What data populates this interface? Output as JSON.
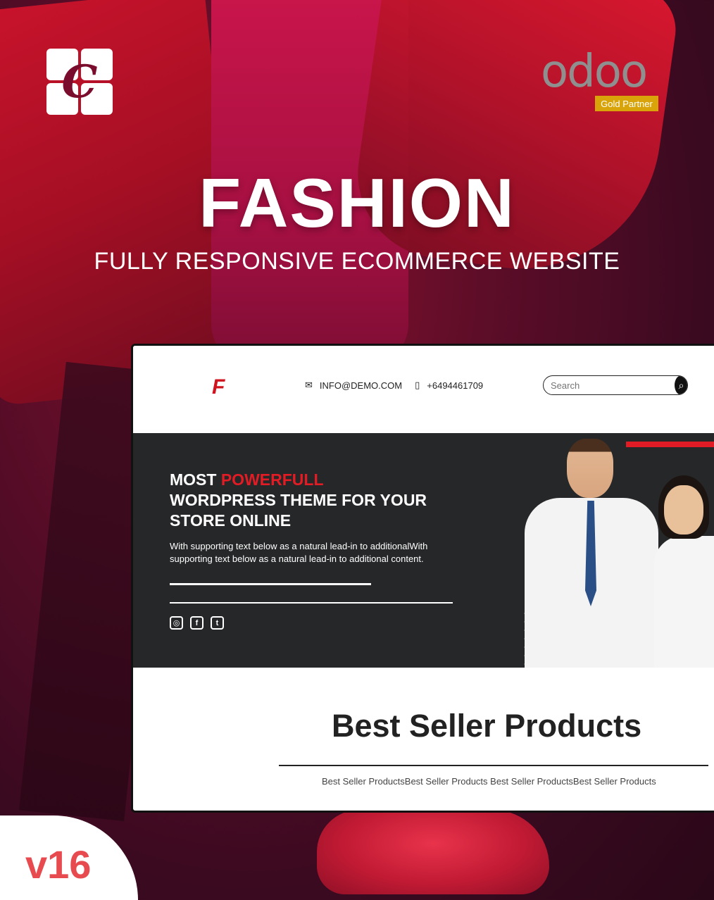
{
  "brand": {
    "logo_letter": "C"
  },
  "partner": {
    "name": "odoo",
    "badge": "Gold Partner"
  },
  "hero": {
    "title": "FASHION",
    "subtitle": "FULLY RESPONSIVE ECOMMERCE WEBSITE"
  },
  "mock_site": {
    "logo": "F",
    "email": "INFO@DEMO.COM",
    "phone": "+6494461709",
    "search_placeholder": "Search",
    "banner": {
      "headline_part1": "MOST ",
      "headline_highlight": "POWERFULL",
      "headline_part2": "WORDPRESS THEME FOR YOUR STORE ONLINE",
      "body": "With supporting text below as a natural lead-in to additionalWith supporting text below as a natural lead-in to additional content."
    },
    "section_title": "Best Seller Products",
    "section_sub": "Best Seller ProductsBest Seller Products Best Seller ProductsBest Seller Products"
  },
  "version": "v16",
  "colors": {
    "accent": "#e21c24",
    "gold": "#d9a409",
    "version": "#e84b4f"
  }
}
